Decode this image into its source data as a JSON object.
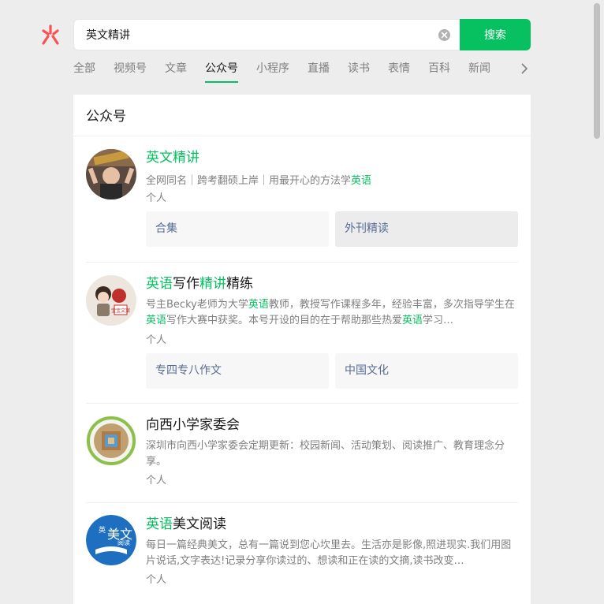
{
  "search": {
    "value": "英文精讲",
    "button_label": "搜索"
  },
  "tabs": [
    {
      "label": "全部",
      "active": false
    },
    {
      "label": "视频号",
      "active": false
    },
    {
      "label": "文章",
      "active": false
    },
    {
      "label": "公众号",
      "active": true
    },
    {
      "label": "小程序",
      "active": false
    },
    {
      "label": "直播",
      "active": false
    },
    {
      "label": "读书",
      "active": false
    },
    {
      "label": "表情",
      "active": false
    },
    {
      "label": "百科",
      "active": false
    },
    {
      "label": "新闻",
      "active": false
    }
  ],
  "panel": {
    "title": "公众号",
    "results": [
      {
        "title_parts": [
          {
            "t": "英文精讲",
            "hl": true
          }
        ],
        "desc_parts": [
          {
            "t": "全网同名｜跨考翻硕上岸｜用最开心的方法学",
            "hl": false
          },
          {
            "t": "英语",
            "hl": true
          }
        ],
        "type": "个人",
        "tags": [
          "合集",
          "外刊精读"
        ]
      },
      {
        "title_parts": [
          {
            "t": "英语",
            "hl": true
          },
          {
            "t": "写作",
            "hl": false
          },
          {
            "t": "精讲",
            "hl": true
          },
          {
            "t": "精练",
            "hl": false
          }
        ],
        "desc_parts": [
          {
            "t": "号主Becky老师为大学",
            "hl": false
          },
          {
            "t": "英语",
            "hl": true
          },
          {
            "t": "教师，教授写作课程多年，经验丰富，多次指导学生在",
            "hl": false
          },
          {
            "t": "英语",
            "hl": true
          },
          {
            "t": "写作大赛中获奖。本号开设的目的在于帮助那些热爱",
            "hl": false
          },
          {
            "t": "英语",
            "hl": true
          },
          {
            "t": "学习…",
            "hl": false
          }
        ],
        "type": "个人",
        "tags": [
          "专四专八作文",
          "中国文化"
        ]
      },
      {
        "title_parts": [
          {
            "t": "向西小学家委会",
            "hl": false
          }
        ],
        "desc_parts": [
          {
            "t": "深圳市向西小学家委会定期更新：校园新闻、活动策划、阅读推广、教育理念分享。",
            "hl": false
          }
        ],
        "type": "个人",
        "tags": []
      },
      {
        "title_parts": [
          {
            "t": "英语",
            "hl": true
          },
          {
            "t": "美文阅读",
            "hl": false
          }
        ],
        "desc_parts": [
          {
            "t": "每日一篇经典美文，总有一篇说到您心坎里去。生活亦是影像,照进现实.我们用图片说话,文字表达!记录分享你读过的、想读和正在读的文摘,读书改变…",
            "hl": false
          }
        ],
        "type": "个人",
        "tags": []
      }
    ]
  },
  "avatar_texts": {
    "a4_top": "英",
    "a4_mid": "美文",
    "a4_right": "阅读",
    "a2_label": "宝宝文案"
  },
  "colors": {
    "accent": "#07c160",
    "link": "#576b95",
    "background": "#ededed"
  }
}
